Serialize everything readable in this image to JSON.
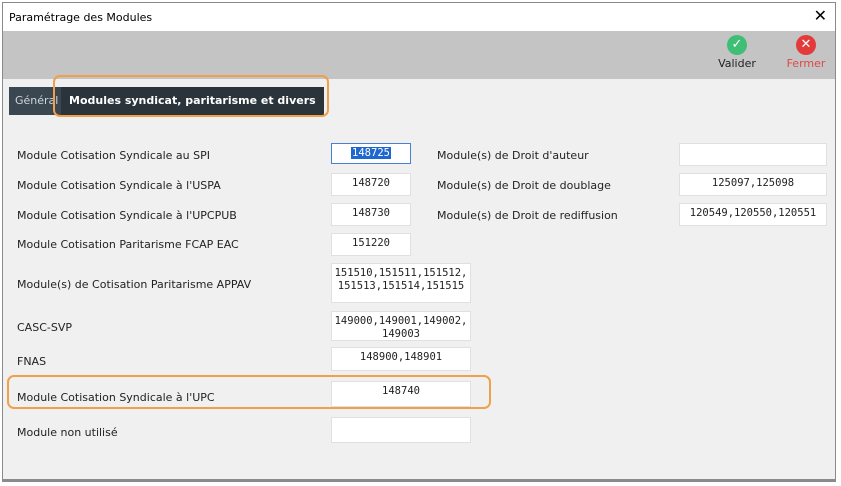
{
  "window": {
    "title": "Paramétrage des Modules",
    "close_glyph": "✕"
  },
  "toolbar": {
    "valider": {
      "label": "Valider",
      "icon": "check-icon",
      "color": "#3fbf76"
    },
    "fermer": {
      "label": "Fermer",
      "icon": "close-circle-icon",
      "color": "#e33b3b"
    }
  },
  "tabs": [
    {
      "label": "Général",
      "active": false
    },
    {
      "label": "Modules syndicat, paritarisme et divers",
      "active": true
    }
  ],
  "left_fields": [
    {
      "label": "Module Cotisation Syndicale au SPI",
      "value": "148725"
    },
    {
      "label": "Module Cotisation Syndicale à l'USPA",
      "value": "148720"
    },
    {
      "label": "Module Cotisation Syndicale à l'UPCPUB",
      "value": "148730"
    },
    {
      "label": "Module Cotisation Paritarisme FCAP EAC",
      "value": "151220"
    },
    {
      "label": "Module(s) de Cotisation Paritarisme APPAV",
      "value_line1": "151510,151511,151512,",
      "value_line2": "151513,151514,151515"
    },
    {
      "label": "CASC-SVP",
      "value_line1": "149000,149001,149002,",
      "value_line2": "149003"
    },
    {
      "label": "FNAS",
      "value": "148900,148901"
    },
    {
      "label": "Module Cotisation Syndicale à l'UPC",
      "value": "148740"
    },
    {
      "label": "Module non utilisé",
      "value": ""
    }
  ],
  "right_fields": [
    {
      "label": "Module(s) de Droit d'auteur",
      "value": ""
    },
    {
      "label": "Module(s) de Droit de doublage",
      "value": "125097,125098"
    },
    {
      "label": "Module(s) de Droit de rediffusion",
      "value": "120549,120550,120551"
    }
  ],
  "highlight_color": "#f0a04b"
}
